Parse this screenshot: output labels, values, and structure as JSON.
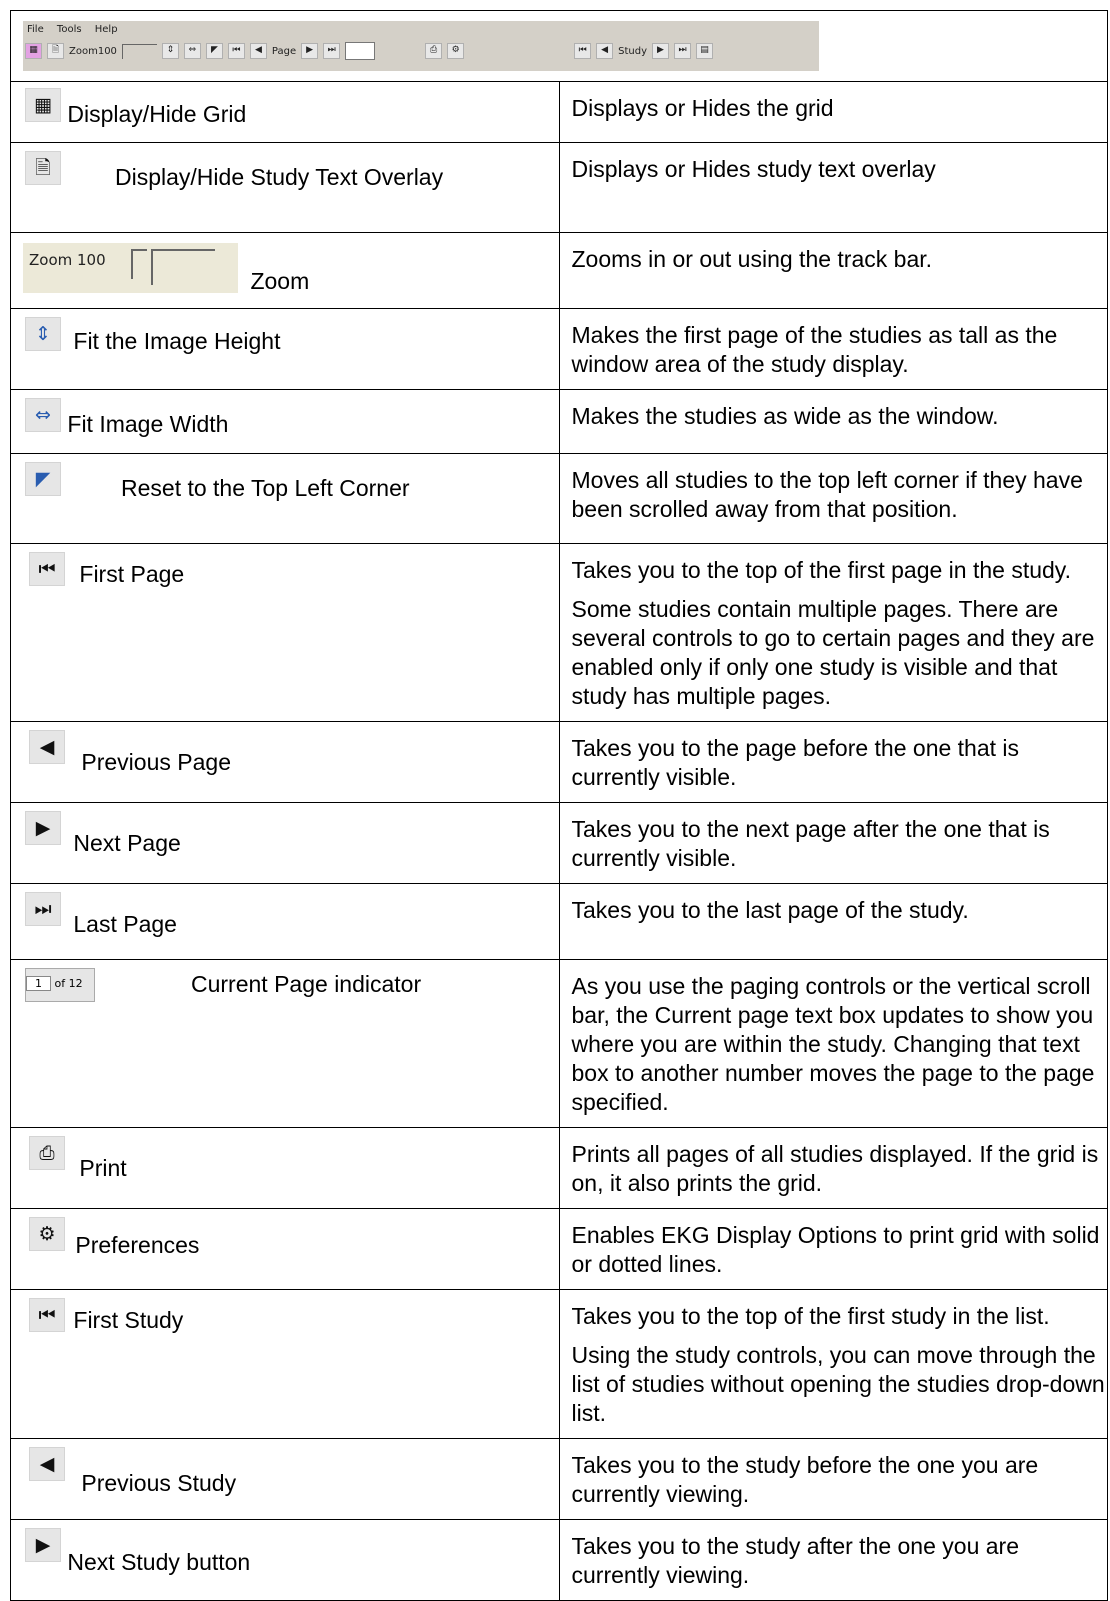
{
  "toolbar": {
    "menu": [
      "File",
      "Tools",
      "Help"
    ],
    "zoom_label": "Zoom100",
    "page_label": "Page",
    "study_label": "Study"
  },
  "rows": [
    {
      "label": "Display/Hide Grid",
      "icon": "grid-icon",
      "desc": [
        "Displays or Hides the grid"
      ]
    },
    {
      "label": "Display/Hide Study Text Overlay",
      "icon": "text-overlay-icon",
      "desc": [
        "Displays or Hides study text overlay"
      ]
    },
    {
      "label": "Zoom",
      "icon": "zoom-trackbar",
      "zoom_text": "Zoom 100",
      "desc": [
        "Zooms in or out using the track bar."
      ]
    },
    {
      "label": "Fit the Image Height",
      "icon": "fit-height-icon",
      "desc": [
        "Makes the first page of the studies as tall as the window area of the study display."
      ]
    },
    {
      "label": "Fit Image Width",
      "icon": "fit-width-icon",
      "desc": [
        "Makes the studies as wide as the window."
      ]
    },
    {
      "label": "Reset to the Top Left Corner",
      "icon": "reset-top-left-icon",
      "desc": [
        "Moves all studies to the top left corner if they have been scrolled away from that position."
      ]
    },
    {
      "label": "First Page",
      "icon": "first-page-icon",
      "desc": [
        "Takes you to the top of the first page in the study.",
        "Some studies contain multiple pages. There are several controls to go to certain pages and they are enabled only if only one study is visible and that study has multiple pages."
      ]
    },
    {
      "label": "Previous Page",
      "icon": "previous-page-icon",
      "desc": [
        "Takes you to the page before the one that is currently visible."
      ]
    },
    {
      "label": "Next Page",
      "icon": "next-page-icon",
      "desc": [
        "Takes you to the next page after the one that is currently visible."
      ]
    },
    {
      "label": "Last Page",
      "icon": "last-page-icon",
      "desc": [
        "Takes you to the last page of the study."
      ]
    },
    {
      "label": "Current Page indicator",
      "icon": "page-indicator",
      "page_current": "1",
      "page_total": "of 12",
      "desc": [
        "As you use the paging controls or the vertical scroll bar, the Current page text box updates to show you where you are within the study. Changing that text box to another number moves the page to the page specified."
      ]
    },
    {
      "label": "Print",
      "icon": "print-icon",
      "desc": [
        "Prints all pages of all studies displayed. If the grid is on, it also prints the grid."
      ]
    },
    {
      "label": "Preferences",
      "icon": "preferences-icon",
      "desc": [
        "Enables EKG Display Options to print grid with solid or dotted lines."
      ]
    },
    {
      "label": "First Study",
      "icon": "first-study-icon",
      "desc": [
        "Takes you to the top of the first study in the list.",
        "Using the study controls, you can move through the list of studies without opening the studies drop-down list."
      ]
    },
    {
      "label": "Previous Study",
      "icon": "previous-study-icon",
      "desc": [
        "Takes you to the study before the one you are currently viewing."
      ]
    },
    {
      "label": "Next Study button",
      "icon": "next-study-icon",
      "desc": [
        "Takes you to the study after the one you are currently viewing."
      ]
    }
  ]
}
